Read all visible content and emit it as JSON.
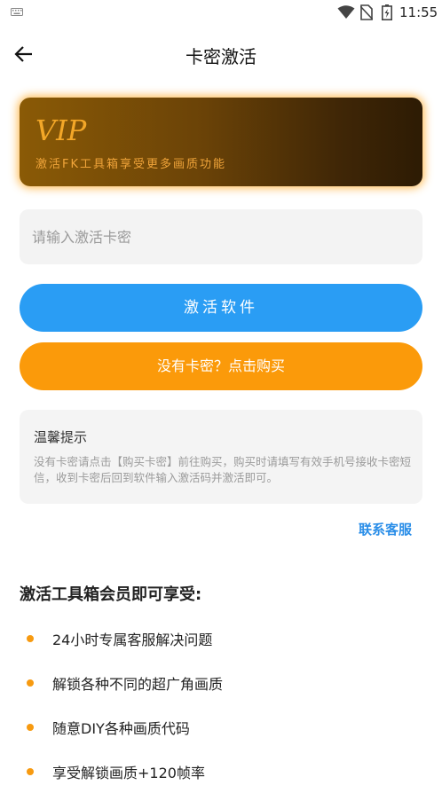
{
  "status_bar": {
    "time": "11:55",
    "icons": [
      "keyboard-icon",
      "wifi-icon",
      "no-sim-icon",
      "battery-icon"
    ]
  },
  "header": {
    "title": "卡密激活",
    "back_icon": "arrow-left-icon"
  },
  "vip_card": {
    "title": "VIP",
    "subtitle": "激活FK工具箱享受更多画质功能"
  },
  "code_input": {
    "placeholder": "请输入激活卡密",
    "value": ""
  },
  "buttons": {
    "activate": "激活软件",
    "buy": "没有卡密？点击购买"
  },
  "tips": {
    "title": "温馨提示",
    "text": "没有卡密请点击【购买卡密】前往购买，购买时请填写有效手机号接收卡密短信，收到卡密后回到软件输入激活码并激活即可。"
  },
  "contact_link": "联系客服",
  "benefits": {
    "heading": "激活工具箱会员即可享受:",
    "items": [
      "24小时专属客服解决问题",
      "解锁各种不同的超广角画质",
      "随意DIY各种画质代码",
      "享受解锁画质+120帧率"
    ]
  },
  "colors": {
    "primary_blue": "#2a9df4",
    "accent_orange": "#fb9a0a",
    "vip_gold": "#f3a728",
    "link_blue": "#2a8ee8"
  }
}
